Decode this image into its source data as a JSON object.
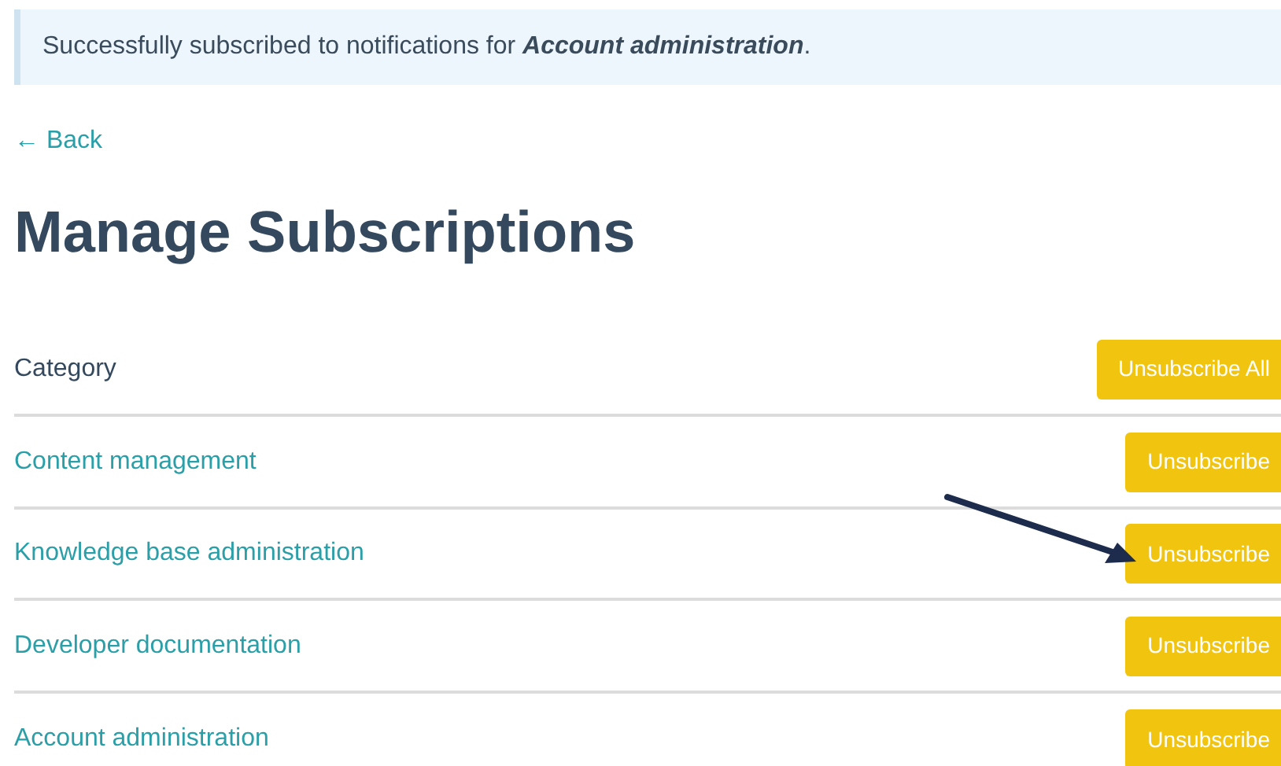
{
  "alert": {
    "text": "Successfully subscribed to notifications for **Account administration**."
  },
  "back_link": "← Back",
  "title": "Manage Subscriptions",
  "table": {
    "header": "Category",
    "header_button": "Unsubscribe All",
    "rows": [
      {
        "category": "Content management",
        "button": "Unsubscribe"
      },
      {
        "category": "Knowledge base administration",
        "button": "Unsubscribe"
      },
      {
        "category": "Developer documentation",
        "button": "Unsubscribe"
      },
      {
        "category": "Account administration",
        "button": "Unsubscribe"
      }
    ]
  }
}
